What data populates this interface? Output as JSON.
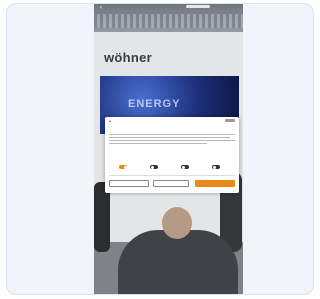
{
  "post": {
    "brand_text": "wöhner",
    "screen_text": "ENERGY"
  },
  "cookie_dialog": {
    "title": "",
    "toggles": [
      {
        "label": "",
        "on": true
      },
      {
        "label": "",
        "on": false
      },
      {
        "label": "",
        "on": false
      },
      {
        "label": "",
        "on": false
      }
    ],
    "buttons": {
      "settings": "",
      "reject": "",
      "accept": ""
    },
    "accent_color": "#e88a1a"
  }
}
